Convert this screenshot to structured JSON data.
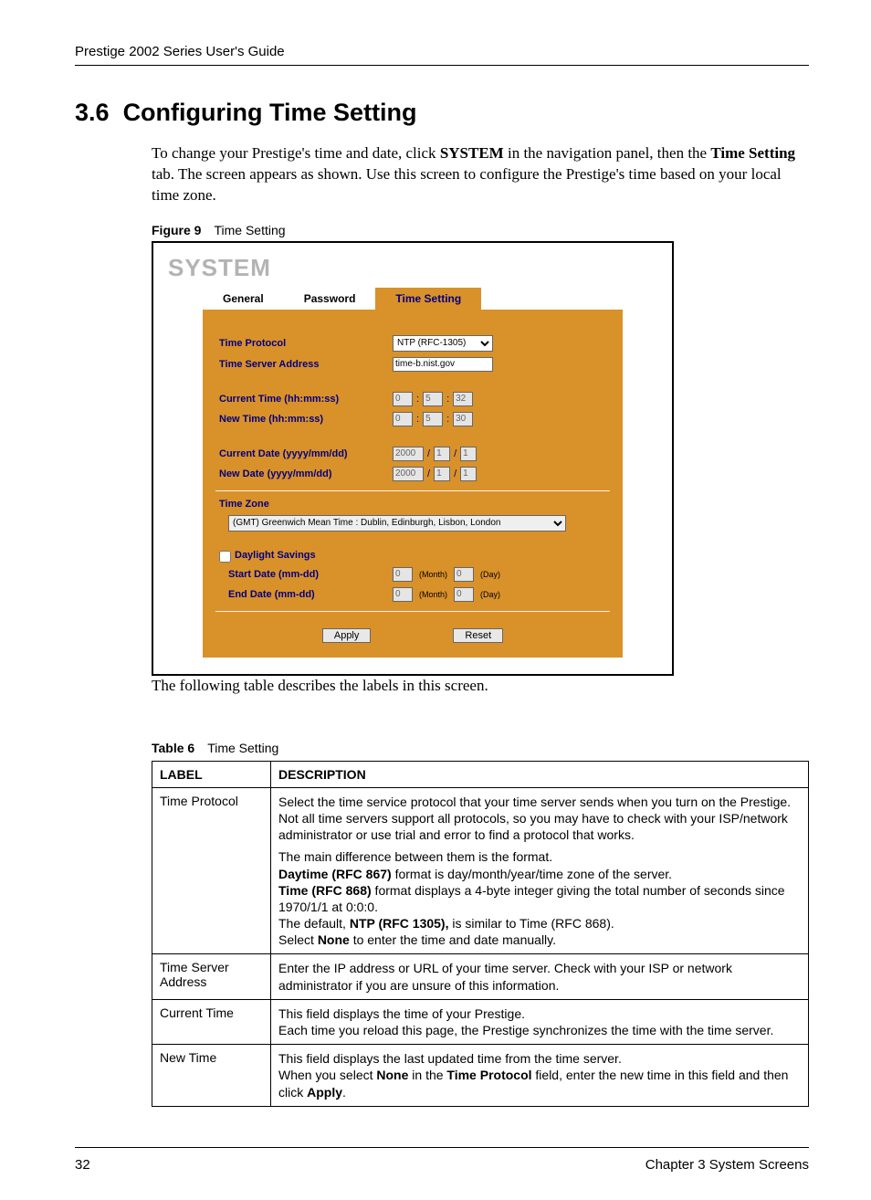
{
  "header": {
    "running": "Prestige 2002 Series User's Guide"
  },
  "section": {
    "number": "3.6",
    "title": "Configuring Time Setting",
    "para": [
      "To change your Prestige's time and date, click ",
      "SYSTEM",
      " in the navigation panel, then the ",
      "Time Setting",
      " tab. The screen appears as shown. Use this screen to configure the Prestige's time based on your local time zone."
    ]
  },
  "figure": {
    "label": "Figure 9",
    "caption": "Time Setting"
  },
  "shot": {
    "title": "SYSTEM",
    "tabs": {
      "general": "General",
      "password": "Password",
      "time": "Time Setting"
    },
    "labels": {
      "time_protocol": "Time Protocol",
      "time_server": "Time Server Address",
      "current_time": "Current Time (hh:mm:ss)",
      "new_time": "New Time (hh:mm:ss)",
      "current_date": "Current Date (yyyy/mm/dd)",
      "new_date": "New Date (yyyy/mm/dd)",
      "time_zone": "Time Zone",
      "daylight": "Daylight Savings",
      "start_date": "Start Date (mm-dd)",
      "end_date": "End Date (mm-dd)",
      "month": "(Month)",
      "day": "(Day)",
      "apply": "Apply",
      "reset": "Reset"
    },
    "values": {
      "protocol": "NTP (RFC-1305)",
      "server": "time-b.nist.gov",
      "cur_time": [
        "0",
        "5",
        "32"
      ],
      "new_time": [
        "0",
        "5",
        "30"
      ],
      "cur_date": [
        "2000",
        "1",
        "1"
      ],
      "new_date": [
        "2000",
        "1",
        "1"
      ],
      "tz": "(GMT) Greenwich Mean Time : Dublin, Edinburgh, Lisbon, London",
      "dst_checked": false,
      "start": [
        "0",
        "0"
      ],
      "end": [
        "0",
        "0"
      ]
    }
  },
  "after_fig": "The following table describes the labels in this screen.",
  "table": {
    "label": "Table 6",
    "caption": "Time Setting",
    "head": [
      "LABEL",
      "DESCRIPTION"
    ],
    "rows": [
      {
        "label": "Time Protocol",
        "desc_plain": [
          "Select the time service protocol that your time server sends when you turn on the Prestige. Not all time servers support all protocols, so you may have to check with your ISP/network administrator or use trial and error to find a protocol that works."
        ],
        "desc_rich": [
          [
            "The main difference between them is the format."
          ],
          [
            [
              "b",
              "Daytime (RFC 867)"
            ],
            " format is day/month/year/time zone of the server."
          ],
          [
            [
              "b",
              "Time (RFC 868)"
            ],
            " format displays a 4-byte integer giving the total number of seconds since 1970/1/1 at 0:0:0."
          ],
          [
            "The default, ",
            [
              "b",
              "NTP (RFC 1305),"
            ],
            " is similar to Time (RFC 868)."
          ],
          [
            "Select ",
            [
              "b",
              "None"
            ],
            " to enter the time and date manually."
          ]
        ]
      },
      {
        "label": "Time Server Address",
        "desc_plain": [
          "Enter the IP address or URL of your time server. Check with your ISP or network administrator if you are unsure of this information."
        ]
      },
      {
        "label": "Current Time",
        "desc_plain": [
          "This field displays the time of your Prestige.",
          "Each time you reload this page, the Prestige synchronizes the time with the time server."
        ]
      },
      {
        "label": "New Time",
        "desc_rich": [
          [
            "This field displays the last updated time from the time server."
          ],
          [
            "When you select ",
            [
              "b",
              "None"
            ],
            " in the ",
            [
              "b",
              "Time Protocol"
            ],
            " field, enter the new time in this field and then click ",
            [
              "b",
              "Apply"
            ],
            "."
          ]
        ]
      }
    ]
  },
  "footer": {
    "page": "32",
    "chapter": "Chapter 3 System Screens"
  }
}
